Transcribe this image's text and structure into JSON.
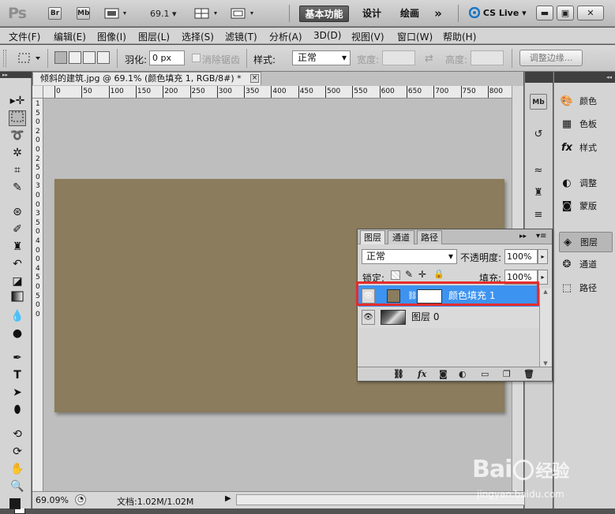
{
  "appbar": {
    "logo": "Ps",
    "bridge": "Br",
    "minibridge": "Mb",
    "zoom": "69.1",
    "workspaces": [
      "基本功能",
      "设计",
      "绘画"
    ],
    "more": "»",
    "cslive": "CS Live"
  },
  "menu": [
    "文件(F)",
    "编辑(E)",
    "图像(I)",
    "图层(L)",
    "选择(S)",
    "滤镜(T)",
    "分析(A)",
    "3D(D)",
    "视图(V)",
    "窗口(W)",
    "帮助(H)"
  ],
  "options": {
    "feather_label": "羽化:",
    "feather_value": "0 px",
    "antialias_label": "消除锯齿",
    "style_label": "样式:",
    "style_value": "正常",
    "width_label": "宽度:",
    "height_label": "高度:",
    "refine_label": "调整边缘..."
  },
  "document": {
    "tab_title": "倾斜的建筑.jpg @ 69.1% (颜色填充 1, RGB/8#) *",
    "close": "×",
    "ruler_ticks": [
      "0",
      "50",
      "100",
      "150",
      "200",
      "250",
      "300",
      "350",
      "400",
      "450",
      "500",
      "550",
      "600",
      "650",
      "700",
      "750",
      "800"
    ],
    "ruler_v_ticks": [
      "1",
      "5",
      "0",
      "2",
      "0",
      "0",
      "2",
      "5",
      "0",
      "3",
      "0",
      "0",
      "3",
      "5",
      "0",
      "4",
      "0",
      "0",
      "4",
      "5",
      "0",
      "5",
      "0",
      "0"
    ],
    "fill_color": "#8a7c5c",
    "zoom": "69.09%",
    "doc_info": "文档:1.02M/1.02M"
  },
  "dock": {
    "collapsed": [
      {
        "name": "颜色",
        "icon": "color-icon"
      },
      {
        "name": "色板",
        "icon": "swatches-icon"
      },
      {
        "name": "样式",
        "icon": "styles-icon"
      },
      {
        "name": "调整",
        "icon": "adjustments-icon"
      },
      {
        "name": "蒙版",
        "icon": "masks-icon"
      },
      {
        "name": "图层",
        "icon": "layers-icon"
      },
      {
        "name": "通道",
        "icon": "channels-icon"
      },
      {
        "name": "路径",
        "icon": "paths-icon"
      }
    ]
  },
  "layers_panel": {
    "tabs": [
      "图层",
      "通道",
      "路径"
    ],
    "blend_mode": "正常",
    "opacity_label": "不透明度:",
    "opacity_value": "100%",
    "lock_label": "锁定:",
    "fill_label": "填充:",
    "fill_value": "100%",
    "layers": [
      {
        "name": "颜色填充 1",
        "selected": true,
        "thumb_color": "#8a7c5c"
      },
      {
        "name": "图层 0",
        "selected": false
      }
    ],
    "footer_fx": "fx"
  },
  "watermark": {
    "brand": "Bai",
    "brand_tail": "经验",
    "url": "jingyan.baidu.com"
  }
}
